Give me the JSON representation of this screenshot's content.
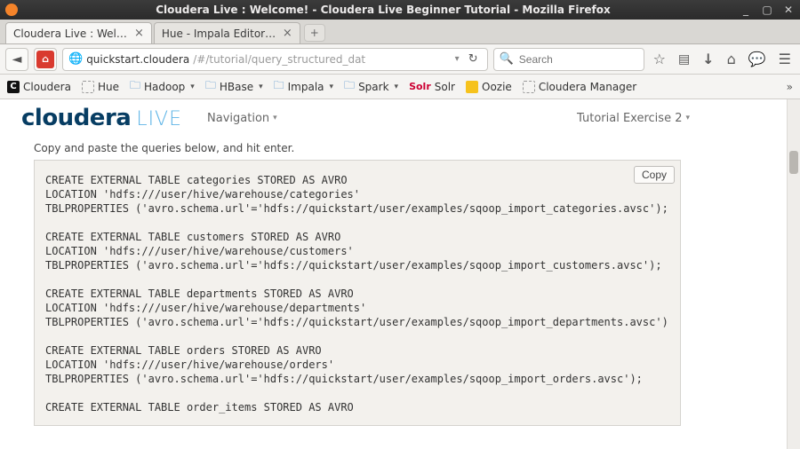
{
  "os_titlebar": {
    "title": "Cloudera Live : Welcome! - Cloudera Live Beginner Tutorial - Mozilla Firefox"
  },
  "tabs": [
    {
      "label": "Cloudera Live : Welcom…",
      "active": true
    },
    {
      "label": "Hue - Impala Editor - Qu…",
      "active": false
    }
  ],
  "url": {
    "host": "quickstart.cloudera",
    "path": "/#/tutorial/query_structured_dat"
  },
  "search": {
    "placeholder": "Search"
  },
  "bookmarks": [
    {
      "kind": "logo",
      "label": "Cloudera"
    },
    {
      "kind": "dashed",
      "label": "Hue"
    },
    {
      "kind": "folder",
      "label": "Hadoop",
      "caret": true
    },
    {
      "kind": "folder",
      "label": "HBase",
      "caret": true
    },
    {
      "kind": "folder",
      "label": "Impala",
      "caret": true
    },
    {
      "kind": "folder",
      "label": "Spark",
      "caret": true
    },
    {
      "kind": "solr",
      "label": "Solr"
    },
    {
      "kind": "yellow",
      "label": "Oozie"
    },
    {
      "kind": "dashed",
      "label": "Cloudera Manager"
    }
  ],
  "header": {
    "brand": "cloudera",
    "live": "LIVE",
    "nav_label": "Navigation",
    "right_label": "Tutorial Exercise 2"
  },
  "instruction": "Copy and paste the queries below, and hit enter.",
  "copy_label": "Copy",
  "sql": "CREATE EXTERNAL TABLE categories STORED AS AVRO\nLOCATION 'hdfs:///user/hive/warehouse/categories'\nTBLPROPERTIES ('avro.schema.url'='hdfs://quickstart/user/examples/sqoop_import_categories.avsc');\n\nCREATE EXTERNAL TABLE customers STORED AS AVRO\nLOCATION 'hdfs:///user/hive/warehouse/customers'\nTBLPROPERTIES ('avro.schema.url'='hdfs://quickstart/user/examples/sqoop_import_customers.avsc');\n\nCREATE EXTERNAL TABLE departments STORED AS AVRO\nLOCATION 'hdfs:///user/hive/warehouse/departments'\nTBLPROPERTIES ('avro.schema.url'='hdfs://quickstart/user/examples/sqoop_import_departments.avsc');\n\nCREATE EXTERNAL TABLE orders STORED AS AVRO\nLOCATION 'hdfs:///user/hive/warehouse/orders'\nTBLPROPERTIES ('avro.schema.url'='hdfs://quickstart/user/examples/sqoop_import_orders.avsc');\n\nCREATE EXTERNAL TABLE order_items STORED AS AVRO"
}
